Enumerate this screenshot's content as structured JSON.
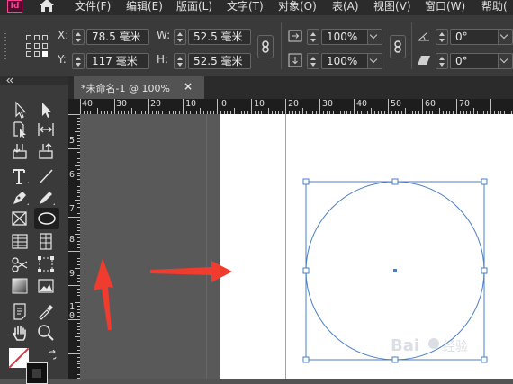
{
  "app": {
    "logo_text": "Id"
  },
  "menu": [
    "文件(F)",
    "编辑(E)",
    "版面(L)",
    "文字(T)",
    "对象(O)",
    "表(A)",
    "视图(V)",
    "窗口(W)",
    "帮助("
  ],
  "control": {
    "x_label": "X:",
    "x_value": "78.5 毫米",
    "y_label": "Y:",
    "y_value": "117 毫米",
    "w_label": "W:",
    "w_value": "52.5 毫米",
    "h_label": "H:",
    "h_value": "52.5 毫米",
    "scale_x": "100%",
    "scale_y": "100%",
    "rotate": "0°",
    "shear": "0°"
  },
  "document": {
    "tab_title": "*未命名-1 @ 100%",
    "tab_close": "×",
    "h_ruler_labels": [
      "40",
      "30",
      "20",
      "10",
      "0",
      "10",
      "20",
      "30",
      "40",
      "50",
      "60",
      "70"
    ],
    "v_ruler_labels": [
      "5",
      "6",
      "7",
      "8",
      "9",
      "10"
    ]
  },
  "colors": {
    "circle_stroke": "#4a7fc8",
    "annotation_arrow": "#f03c2e",
    "bleed_line": "#e0323a"
  },
  "icons": [
    "home-icon",
    "reference-point-icon",
    "constrain-proportions-icon",
    "selection-tool-icon",
    "direct-selection-tool-icon",
    "page-tool-icon",
    "gap-tool-icon",
    "content-collector-icon",
    "type-tool-icon",
    "line-tool-icon",
    "pen-tool-icon",
    "pencil-tool-icon",
    "rectangle-frame-tool-icon",
    "ellipse-tool-icon",
    "table-icon",
    "scissors-tool-icon",
    "free-transform-tool-icon",
    "gradient-swatch-tool-icon",
    "note-tool-icon",
    "eyedropper-tool-icon",
    "hand-tool-icon",
    "zoom-tool-icon",
    "fill-stroke-icon",
    "swap-fill-stroke-icon"
  ],
  "watermark": "Baidu 经验"
}
